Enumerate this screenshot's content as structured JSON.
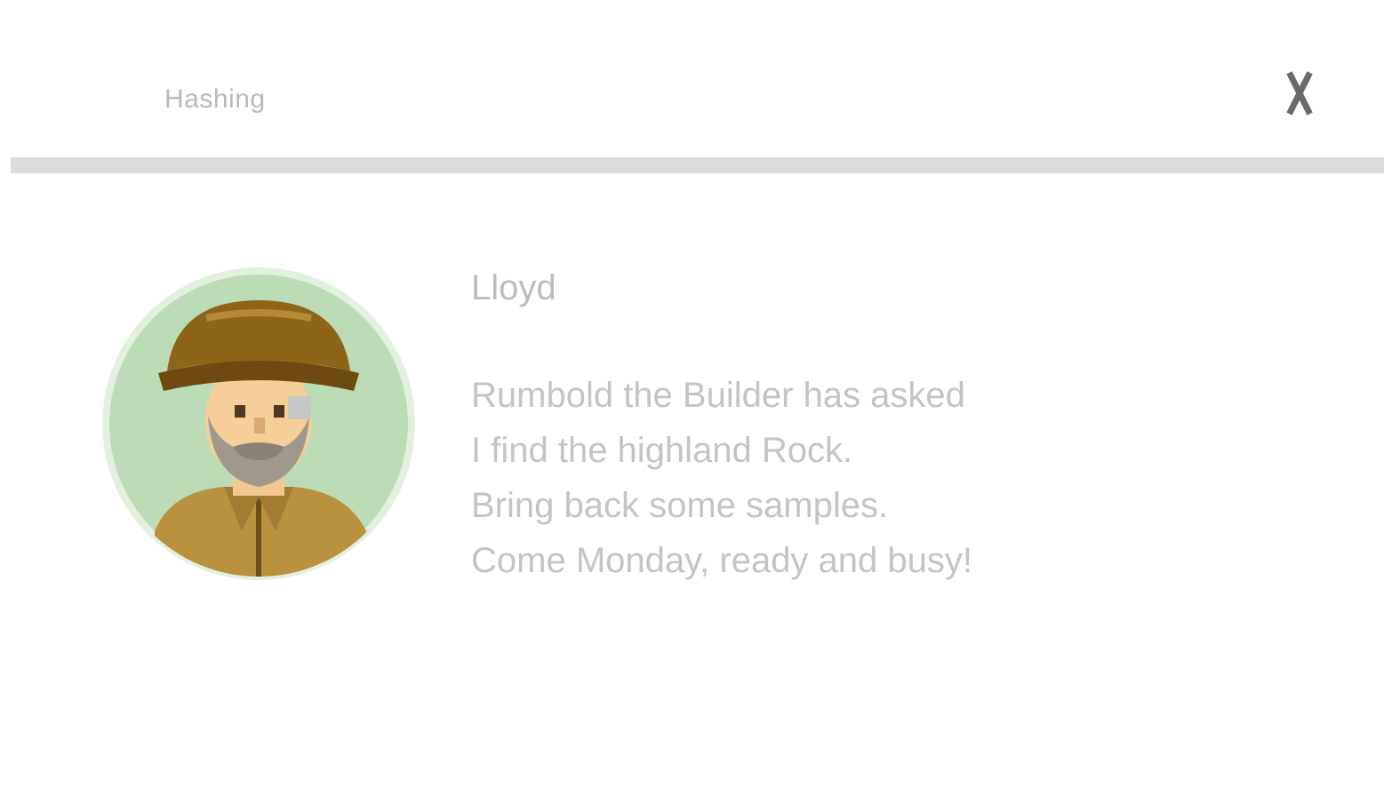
{
  "header": {
    "title": "Hashing",
    "close_icon": "close-icon"
  },
  "profile": {
    "avatar_icon": "bearded-man-in-hat-avatar",
    "name": "Lloyd",
    "message_lines": [
      "Rumbold the Builder has asked",
      "I find the highland Rock.",
      "Bring back some samples.",
      "Come Monday, ready and busy!"
    ]
  },
  "colors": {
    "title_text": "#b9b9b9",
    "body_text": "#c4c4c4",
    "divider": "#dcdcdc",
    "avatar_bg": "#bcdcb8",
    "hat": "#8e6418",
    "coat": "#b9913f"
  }
}
